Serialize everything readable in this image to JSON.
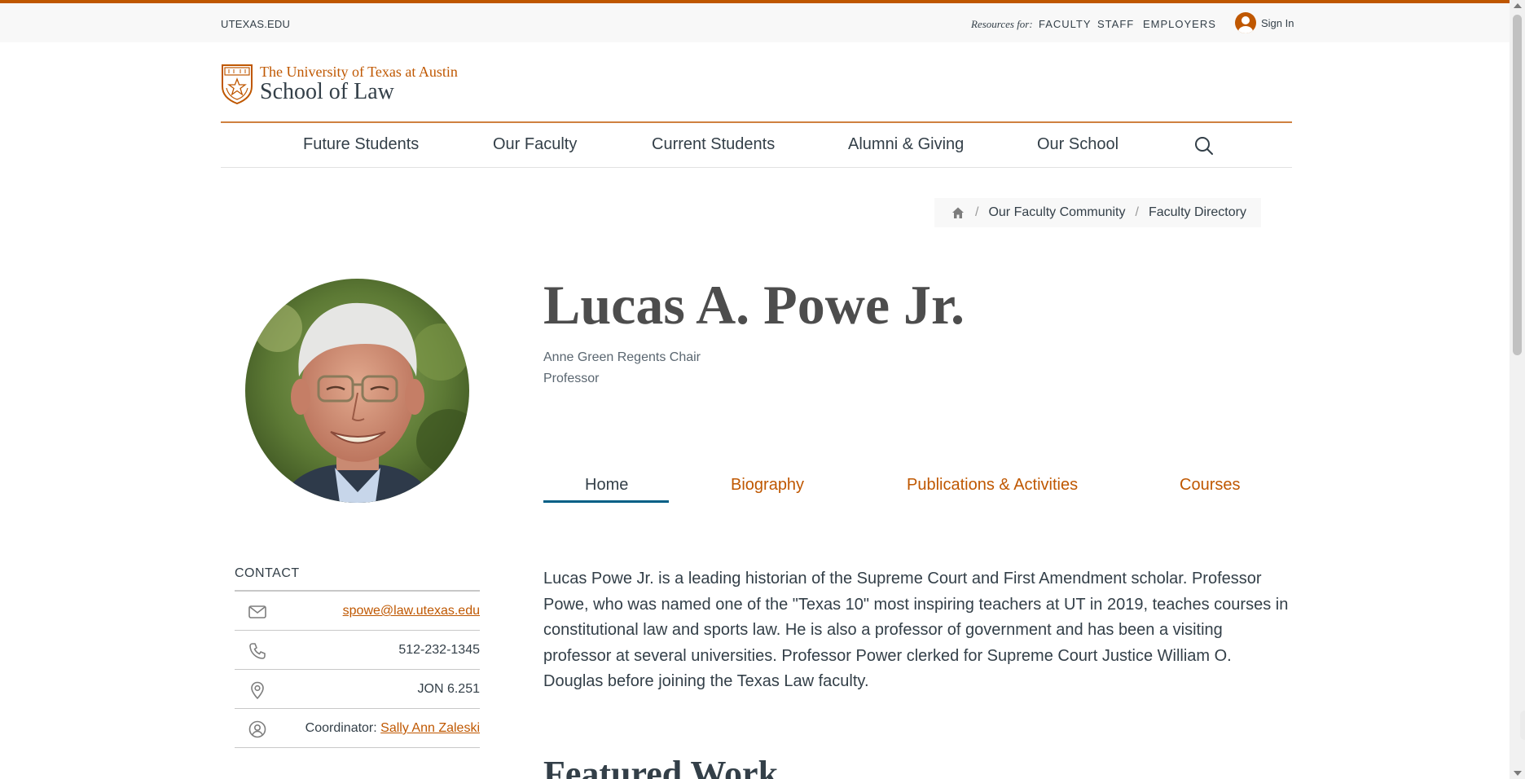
{
  "topbar": {
    "utexas_label": "UTEXAS.EDU",
    "resources_label": "Resources for:",
    "resources": [
      "FACULTY",
      "STAFF",
      "EMPLOYERS"
    ],
    "signin_label": "Sign In",
    "signin_icon": "user-circle-icon"
  },
  "brand": {
    "line1": "The University of Texas at Austin",
    "line2": "School of Law",
    "shield_icon": "ut-shield-icon",
    "accent_color": "#bf5700"
  },
  "nav": {
    "items": [
      "Future Students",
      "Our Faculty",
      "Current Students",
      "Alumni & Giving",
      "Our School"
    ],
    "search_icon": "search-icon"
  },
  "breadcrumb": {
    "home_icon": "home-icon",
    "items": [
      "Our Faculty Community",
      "Faculty Directory"
    ]
  },
  "profile": {
    "name": "Lucas A. Powe Jr.",
    "titles": [
      "Anne Green Regents Chair",
      "Professor"
    ]
  },
  "tabs": {
    "items": [
      "Home",
      "Biography",
      "Publications & Activities",
      "Courses"
    ],
    "active": "Home",
    "active_color": "#005f86"
  },
  "contact": {
    "heading": "CONTACT",
    "email": "spowe@law.utexas.edu",
    "phone": "512-232-1345",
    "office": "JON 6.251",
    "coordinator_label": "Coordinator:",
    "coordinator_name": "Sally Ann Zaleski",
    "icons": [
      "envelope-icon",
      "phone-icon",
      "map-pin-icon",
      "person-circle-icon"
    ]
  },
  "bio": {
    "text": "Lucas Powe Jr. is a leading historian of the Supreme Court and First Amendment scholar. Professor Powe, who was named one of the \"Texas 10\" most inspiring teachers at UT in 2019, teaches courses in constitutional law and sports law. He is also a professor of government and has been a visiting professor at several universities. Professor Power clerked for Supreme Court Justice William O. Douglas before joining the Texas Law faculty."
  },
  "featured": {
    "heading": "Featured Work"
  }
}
